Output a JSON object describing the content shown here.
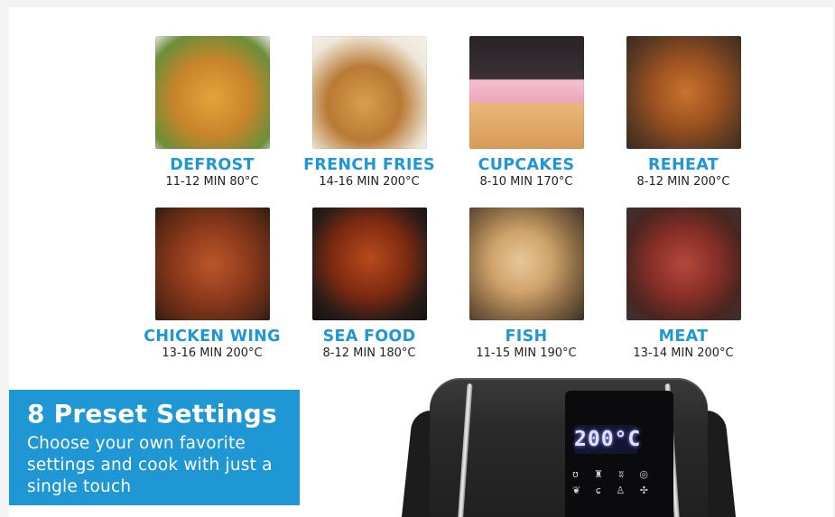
{
  "colors": {
    "accent": "#1e97d4",
    "text_dark": "#222222",
    "background": "#ffffff"
  },
  "presets": [
    {
      "name": "DEFROST",
      "info": "11-12 MIN 80°C"
    },
    {
      "name": "FRENCH FRIES",
      "info": "14-16 MIN 200°C"
    },
    {
      "name": "CUPCAKES",
      "info": "8-10 MIN 170°C"
    },
    {
      "name": "REHEAT",
      "info": "8-12 MIN 200°C"
    },
    {
      "name": "CHICKEN WING",
      "info": "13-16 MIN 200°C"
    },
    {
      "name": "SEA FOOD",
      "info": "8-12 MIN 180°C"
    },
    {
      "name": "FISH",
      "info": "11-15 MIN 190°C"
    },
    {
      "name": "MEAT",
      "info": "13-14 MIN 200°C"
    }
  ],
  "feature_box": {
    "title": "8 Preset Settings",
    "lines": [
      "Choose your own favorite",
      "settings and cook with just a",
      "single touch"
    ]
  },
  "air_fryer": {
    "display_value": "200°C"
  }
}
